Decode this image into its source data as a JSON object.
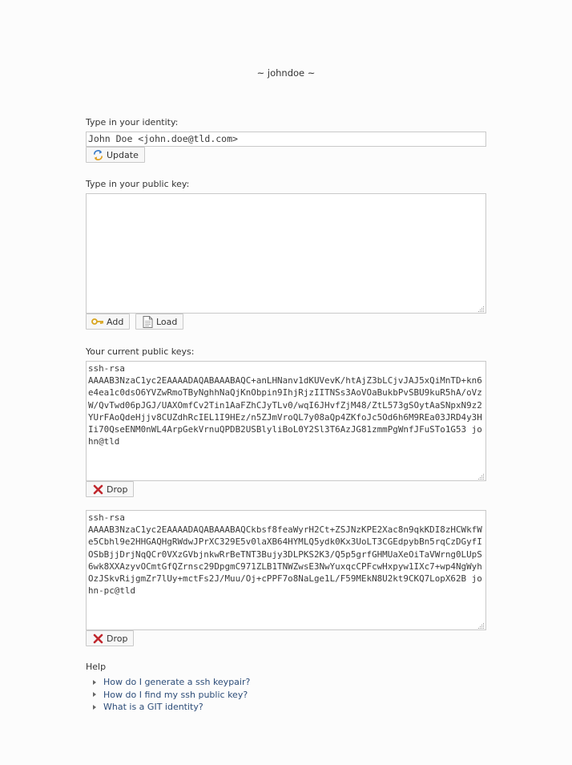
{
  "header": {
    "title": "~ johndoe ~"
  },
  "identity": {
    "label": "Type in your identity:",
    "value": "John Doe <john.doe@tld.com>",
    "update_label": "Update"
  },
  "public_key": {
    "label": "Type in your public key:",
    "value": "",
    "add_label": "Add",
    "load_label": "Load"
  },
  "current_keys": {
    "label": "Your current public keys:",
    "keys": [
      {
        "value": "ssh-rsa\nAAAAB3NzaC1yc2EAAAADAQABAAABAQC+anLHNanv1dKUVevK/htAjZ3bLCjvJAJ5xQiMnTD+kn6e4ea1c0dsO6YVZwRmoTByNghhNaQjKnObpin9IhjRjzIITNSs3AoVOaBukbPvSBU9kuR5hA/oVzW/QvTwd06pJGJ/UAXOmfCv2Tin1AaFZhCJyTLv0/wqI6JHvfZjM48/ZtL573gSOytAaSNpxN9z2YUrFAoQdeHjjv8CUZdhRcIEL1I9HEz/n5ZJmVroQL7y08aQp4ZKfoJc5Od6h6M9REa03JRD4y3HIi70QseENM0nWL4ArpGekVrnuQPDB2USBlyliBoL0Y2Sl3T6AzJG81zmmPgWnfJFuSTo1G53 john@tld",
        "drop_label": "Drop"
      },
      {
        "value": "ssh-rsa\nAAAAB3NzaC1yc2EAAAADAQABAAABAQCkbsf8feaWyrH2Ct+ZSJNzKPE2Xac8n9qkKDI8zHCWkfWe5Cbhl9e2HHGAQHgRWdwJPrXC329E5v0laXB64HYMLQ5ydk0Kx3UoLT3CGEdpybBn5rqCzDGyfIOSbBjjDrjNqQCr0VXzGVbjnkwRrBeTNT3Bujy3DLPKS2K3/Q5p5grfGHMUaXeOiTaVWrng0LUpS6wk8XXAzyvOCmtGfQZrnsc29DpgmC971ZLB1TNWZwsE3NwYuxqcCPFcwHxpyw1IXc7+wp4NgWyhOzJSkvRijgmZr7lUy+mctFs2J/Muu/Oj+cPPF7o8NaLge1L/F59MEkN8U2kt9CKQ7LopX62B john-pc@tld",
        "drop_label": "Drop"
      }
    ]
  },
  "help": {
    "title": "Help",
    "links": [
      "How do I generate a ssh keypair?",
      "How do I find my ssh public key?",
      "What is a GIT identity?"
    ]
  },
  "colors": {
    "link": "#2c4c78",
    "border": "#c9c9c9",
    "drop_icon": "#c0272d"
  }
}
